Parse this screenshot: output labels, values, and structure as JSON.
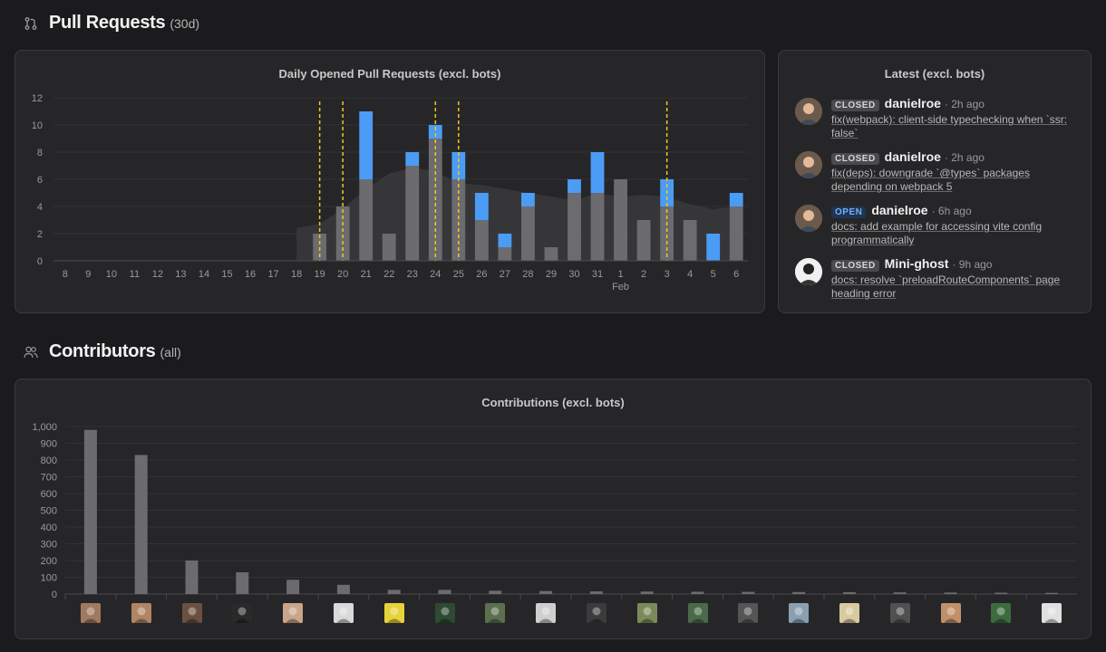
{
  "pull_requests": {
    "title": "Pull Requests",
    "sub": "(30d)",
    "icon": "git-pull-request-icon"
  },
  "daily_chart": {
    "title": "Daily Opened Pull Requests (excl. bots)",
    "month_label": "Feb",
    "colors": {
      "gray": "#6b6b70",
      "blue": "#4b9cf5",
      "area": "#38383b",
      "release_line": "#f5c518"
    }
  },
  "latest": {
    "title": "Latest (excl. bots)",
    "items": [
      {
        "status": "CLOSED",
        "user": "danielroe",
        "time": "· 2h ago",
        "title": "fix(webpack): client-side typechecking when `ssr: false`"
      },
      {
        "status": "CLOSED",
        "user": "danielroe",
        "time": "· 2h ago",
        "title": "fix(deps): downgrade `@types` packages depending on webpack 5"
      },
      {
        "status": "OPEN",
        "user": "danielroe",
        "time": "· 6h ago",
        "title": "docs: add example for accessing vite config programmatically"
      },
      {
        "status": "CLOSED",
        "user": "Mini-ghost",
        "time": "· 9h ago",
        "title": "docs: resolve `preloadRouteComponents` page heading error"
      }
    ]
  },
  "contributors": {
    "title": "Contributors",
    "sub": "(all)",
    "icon": "people-icon"
  },
  "contrib_chart": {
    "title": "Contributions (excl. bots)",
    "color": "#6b6b70"
  },
  "chart_data": [
    {
      "type": "bar",
      "title": "Daily Opened Pull Requests (excl. bots)",
      "categories": [
        "8",
        "9",
        "10",
        "11",
        "12",
        "13",
        "14",
        "15",
        "16",
        "17",
        "18",
        "19",
        "20",
        "21",
        "22",
        "23",
        "24",
        "25",
        "26",
        "27",
        "28",
        "29",
        "30",
        "31",
        "1",
        "2",
        "3",
        "4",
        "5",
        "6"
      ],
      "series": [
        {
          "values": [
            0,
            0,
            0,
            0,
            0,
            0,
            0,
            0,
            0,
            0,
            0,
            2,
            4,
            6,
            2,
            7,
            9,
            6,
            3,
            1,
            4,
            1,
            5,
            5,
            6,
            3,
            4,
            3,
            0,
            4
          ]
        },
        {
          "values": [
            0,
            0,
            0,
            0,
            0,
            0,
            0,
            0,
            0,
            0,
            0,
            0,
            0,
            5,
            0,
            1,
            1,
            2,
            2,
            1,
            1,
            0,
            1,
            3,
            0,
            0,
            2,
            0,
            2,
            1
          ]
        }
      ],
      "release_markers": [
        "19",
        "20",
        "24",
        "25",
        "3"
      ],
      "xlabel_secondary": "Feb",
      "ylim": [
        0,
        12
      ],
      "yticks": [
        0,
        2,
        4,
        6,
        8,
        10,
        12
      ],
      "stacked": true,
      "grid": true
    },
    {
      "type": "bar",
      "title": "Contributions (excl. bots)",
      "values": [
        980,
        830,
        200,
        130,
        85,
        55,
        25,
        25,
        20,
        18,
        16,
        15,
        14,
        13,
        12,
        11,
        10,
        9,
        8,
        7
      ],
      "ylim": [
        0,
        1000
      ],
      "yticks": [
        "0",
        "100",
        "200",
        "300",
        "400",
        "500",
        "600",
        "700",
        "800",
        "900",
        "1,000"
      ],
      "grid": true
    }
  ]
}
